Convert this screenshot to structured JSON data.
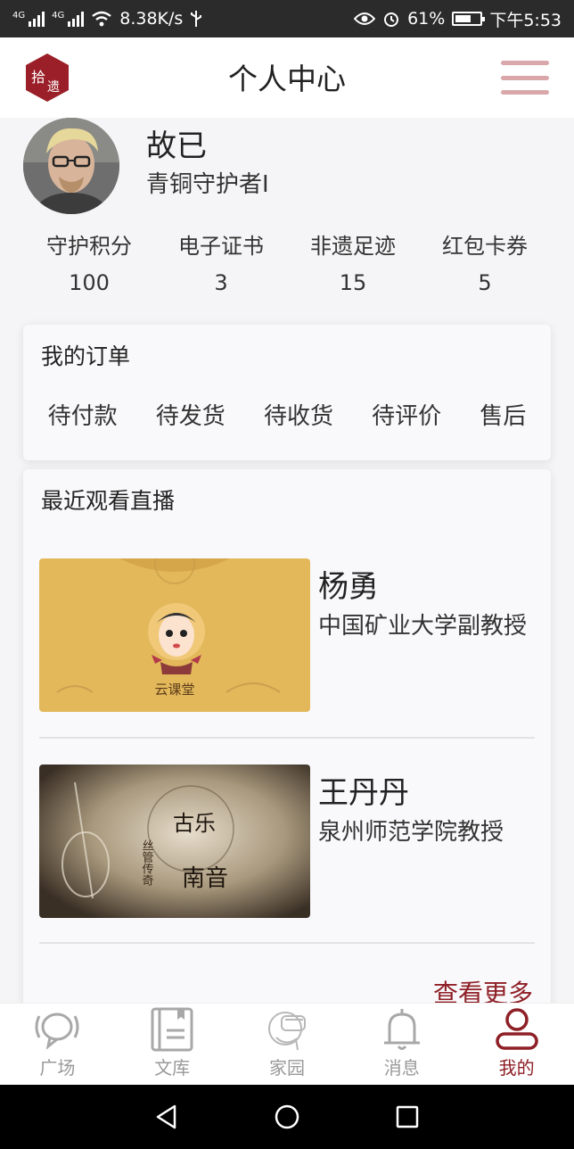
{
  "status_bar": {
    "network_speed": "8.38K/s",
    "battery": "61%",
    "time": "下午5:53",
    "signal_label": "4G"
  },
  "header": {
    "logo_text_1": "拾",
    "logo_text_2": "遗",
    "title": "个人中心"
  },
  "profile": {
    "name": "故已",
    "level": "青铜守护者I"
  },
  "stats": [
    {
      "label": "守护积分",
      "value": "100"
    },
    {
      "label": "电子证书",
      "value": "3"
    },
    {
      "label": "非遗足迹",
      "value": "15"
    },
    {
      "label": "红包卡券",
      "value": "5"
    }
  ],
  "orders": {
    "title": "我的订单",
    "items": [
      "待付款",
      "待发货",
      "待收货",
      "待评价",
      "售后"
    ]
  },
  "recent": {
    "title": "最近观看直播",
    "items": [
      {
        "name": "杨勇",
        "desc": "中国矿业大学副教授",
        "thumb_text": "云课堂"
      },
      {
        "name": "王丹丹",
        "desc": "泉州师范学院教授",
        "thumb_text_1": "古乐",
        "thumb_text_2": "南音",
        "thumb_side": "丝管传奇"
      }
    ],
    "more": "查看更多"
  },
  "tabs": [
    {
      "label": "广场",
      "icon": "chat-bubble-icon"
    },
    {
      "label": "文库",
      "icon": "book-icon"
    },
    {
      "label": "家园",
      "icon": "vr-headset-icon"
    },
    {
      "label": "消息",
      "icon": "bell-icon"
    },
    {
      "label": "我的",
      "icon": "user-icon"
    }
  ],
  "colors": {
    "accent": "#8e1f26",
    "menu": "#d9a7aa",
    "tab_inactive": "#999999"
  }
}
